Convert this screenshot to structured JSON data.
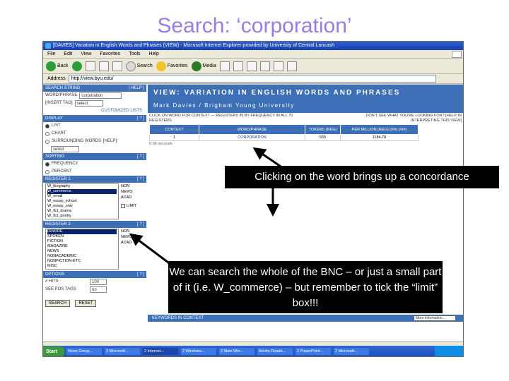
{
  "slide": {
    "title": "Search: ‘corporation’",
    "callout_1": "Clicking on the word brings up a concordance",
    "callout_2": "We can search the whole of the BNC – or just a small part of it (i.e. W_commerce) – but remember to tick the “limit” box!!!"
  },
  "browser": {
    "title": "[DAVIES] Variation in English Words and Phrases (VIEW) - Microsoft Internet Explorer provided by University of Central Lancash",
    "menu": [
      "File",
      "Edit",
      "View",
      "Favorites",
      "Tools",
      "Help"
    ],
    "toolbar": {
      "back": "Back",
      "search": "Search",
      "favorites": "Favorites",
      "media": "Media"
    },
    "address_label": "Address",
    "address": "http://view.byu.edu/"
  },
  "left_panel": {
    "search_string": {
      "header": "SEARCH STRING",
      "help": "[ HELP ]",
      "word_label": "WORD/PHRASE",
      "word_value": "corporation",
      "insert_label": "[INSERT TAG]",
      "insert_value": "select",
      "lists_label": "CUSTOMIZED LISTS"
    },
    "display": {
      "header": "DISPLAY",
      "help": "[ ? ]",
      "options": [
        "LIST",
        "CHART"
      ],
      "surround_label": "SURROUNDING WORDS",
      "surround_help": "[HELP]",
      "surround_value": "select"
    },
    "sorting": {
      "header": "SORTING",
      "help": "[ ? ]",
      "options": [
        "FREQUENCY",
        "PERCENT"
      ]
    },
    "register1": {
      "header": "REGISTER 1",
      "help": "[ ? ]",
      "items": [
        "W_biography",
        "W_commerce",
        "W_email",
        "W_essay_school",
        "W_essay_univ",
        "W_fict_drama",
        "W_fict_poetry"
      ],
      "selected_index": 1,
      "side": [
        "NON",
        "NEWS",
        "ACAD"
      ],
      "limit_label": "LIMIT"
    },
    "register2": {
      "header": "REGISTER 2",
      "help": "[ ? ]",
      "items": [
        "IGNORE",
        "SPOKEN",
        "FICTION",
        "MAGAZINE",
        "NEWS",
        "NONACADEMIC",
        "NONFICTION-ETC",
        "MISC"
      ],
      "selected_index": 0,
      "side": [
        "NON",
        "NEWS",
        "ACAD"
      ]
    },
    "options": {
      "header": "OPTIONS",
      "help": "[ ? ]",
      "hits_label": "# HITS",
      "hits_value": "100",
      "tag_label": "SEE POS TAGS",
      "tag_value": "no"
    },
    "buttons": {
      "search": "SEARCH",
      "reset": "RESET"
    }
  },
  "main_panel": {
    "banner_title": "VIEW: VARIATION IN ENGLISH WORDS AND PHRASES",
    "banner_subtitle": "Mark Davies / Brigham Young University",
    "info_left": "CLICK ON WORD FOR CONTEXT — REGISTERS IN BY FREQUENCY IN ALL 70 REGISTERS",
    "info_right": "DON'T SEE WHAT YOU'RE LOOKING FOR? [HELP IN INTERPRETING THIS VIEW]",
    "table": {
      "headers": [
        "CONTEXT",
        "WORD/PHRASE",
        "TOKENS (REG)",
        "PER MILLION (REG) (#/#) (#/#)"
      ],
      "rows": [
        [
          "1",
          "CORPORATION",
          "555",
          "1184.78"
        ]
      ]
    },
    "seconds": "0.08 seconds",
    "kwic_label": "KEYWORDS IN CONTEXT",
    "kwic_select": "More information..."
  },
  "taskbar": {
    "start": "Start",
    "items": [
      "News Group...",
      "3 Microsoft...",
      "2 Internet...",
      "2 Windows...",
      "2 Main Win...",
      "Adobe Reade...",
      "2 PowerPoint...",
      "2 Microsoft..."
    ],
    "active_index": 2
  },
  "colors": {
    "title": "#9a7de0",
    "panel_blue": "#3d6fb7",
    "callout_bg": "#000000"
  }
}
